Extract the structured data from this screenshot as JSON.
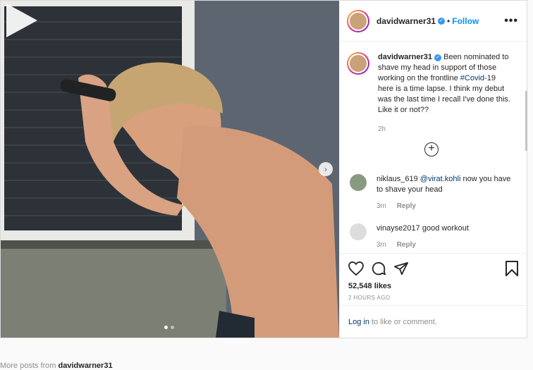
{
  "post": {
    "username": "davidwarner31",
    "follow_label": "Follow",
    "separator": "•",
    "more_options": "•••",
    "caption": {
      "username": "davidwarner31",
      "text_before": "Been nominated to shave my head in support of those working on the frontline ",
      "hashtag": "#Covid",
      "text_after": "-19 here is a time lapse. I think my debut was the last time I recall I've done this. Like it or not??",
      "time": "2h"
    },
    "load_more": "+",
    "comments": [
      {
        "username": "niklaus_619",
        "mention": "@virat.kohli",
        "text": " now you have to shave your head",
        "time": "3m",
        "reply": "Reply"
      },
      {
        "username": "vinayse2017",
        "mention": "",
        "text": " good workout",
        "time": "3m",
        "reply": "Reply"
      }
    ],
    "likes": "52,548 likes",
    "posted": "2 HOURS AGO",
    "login_link": "Log in",
    "login_text": "to like or comment."
  },
  "footer": {
    "more_posts_prefix": "More posts from ",
    "more_posts_user": "davidwarner31"
  },
  "colors": {
    "link": "#0095f6",
    "hashtag": "#00376b",
    "muted": "#8e8e8e"
  }
}
